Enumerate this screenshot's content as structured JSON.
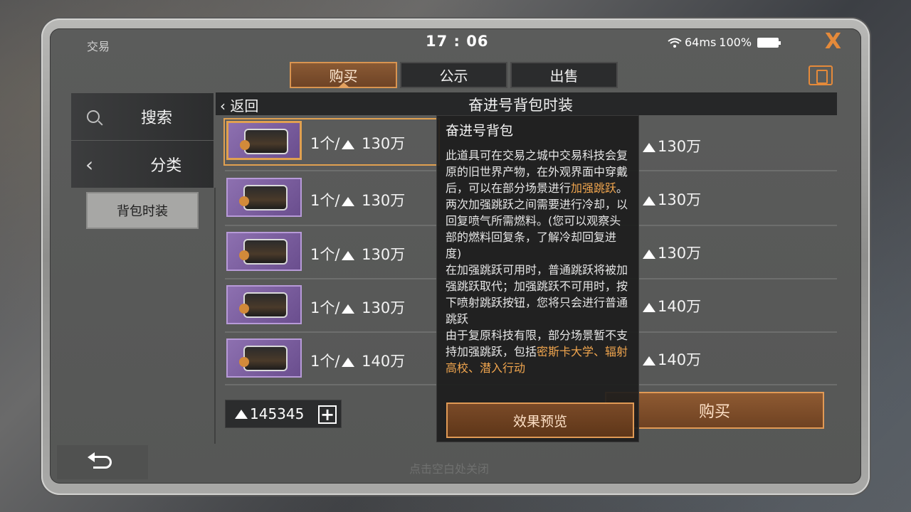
{
  "status_bar": {
    "app_title": "交易",
    "clock": "17 : 06",
    "ping": "64ms",
    "battery": "100%",
    "close_icon": "X"
  },
  "tabs": [
    {
      "label": "购买",
      "active": true
    },
    {
      "label": "公示",
      "active": false
    },
    {
      "label": "出售",
      "active": false
    }
  ],
  "sidebar": {
    "search_label": "搜索",
    "category_label": "分类",
    "subcategory_label": "背包时装"
  },
  "list": {
    "back_label": "返回",
    "title": "奋进号背包时装",
    "rows": [
      {
        "qty_label": "1个/",
        "price": "130万",
        "selected": true
      },
      {
        "qty_label": "1个/",
        "price": "130万",
        "selected": false
      },
      {
        "qty_label": "1个/",
        "price": "130万",
        "selected": false
      },
      {
        "qty_label": "1个/",
        "price": "130万",
        "selected": false
      },
      {
        "qty_label": "1个/",
        "price": "140万",
        "selected": false
      }
    ],
    "right_prices": [
      "130万",
      "130万",
      "130万",
      "140万",
      "140万"
    ]
  },
  "currency": {
    "amount": "145345",
    "plus": "+"
  },
  "buy_label": "购买",
  "popup": {
    "title": "奋进号背包",
    "p1a": "此道具可在交易之城中交易科技会复原的旧世界产物，在外观界面中穿戴后，可以在部分场景进行",
    "p1_hl": "加强跳跃",
    "p1b": "。两次加强跳跃之间需要进行冷却，以回复喷气所需燃料。(您可以观察头部的燃料回复条，了解冷却回复进度)",
    "p2": "在加强跳跃可用时，普通跳跃将被加强跳跃取代；加强跳跃不可用时，按下喷射跳跃按钮，您将只会进行普通跳跃",
    "p3a": "由于复原科技有限，部分场景暂不支持加强跳跃，包括",
    "p3_hl": "密斯卡大学、辐射高校、潜入行动",
    "preview_label": "效果预览"
  },
  "hint": "点击空白处关闭",
  "colors": {
    "accent": "#e58a3a",
    "highlight": "#f0a54e",
    "item_bg": "#8d70b0"
  }
}
